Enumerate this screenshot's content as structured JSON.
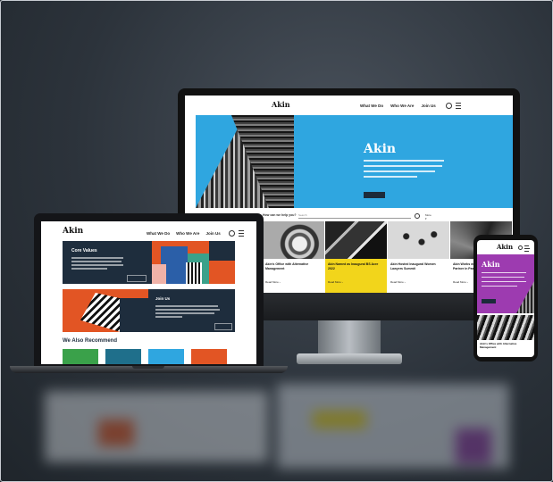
{
  "brand": {
    "logo": "Akin"
  },
  "nav": {
    "items": [
      "What We Do",
      "Who We Are",
      "Join Us"
    ]
  },
  "desktop": {
    "hero": {
      "title": "Akin"
    },
    "help": {
      "label": "How can we help you?",
      "placeholder": "Search",
      "more": "More ▾"
    },
    "cards": [
      {
        "text": "Akin's Office with Alternative Management",
        "highlight": false
      },
      {
        "text": "Akin Named as Inaugural BS Acre 2022",
        "highlight": true
      },
      {
        "text": "Akin Hosted Inaugural Women Lawyers Summit",
        "highlight": false
      },
      {
        "text": "Akin Works with Family Feuds Partner in Passage of Gun Safety Bill",
        "highlight": false
      }
    ],
    "read_more": "Read More ›"
  },
  "laptop": {
    "core_values": {
      "title": "Core Values"
    },
    "join": {
      "title": "Join Us"
    },
    "recommend": {
      "title": "We Also Recommend"
    }
  },
  "colors": {
    "blue": "#2fa6e0",
    "navy": "#1e2d3d",
    "orange": "#e25524",
    "yellow": "#f2d51b",
    "purple": "#9d3bb0"
  }
}
